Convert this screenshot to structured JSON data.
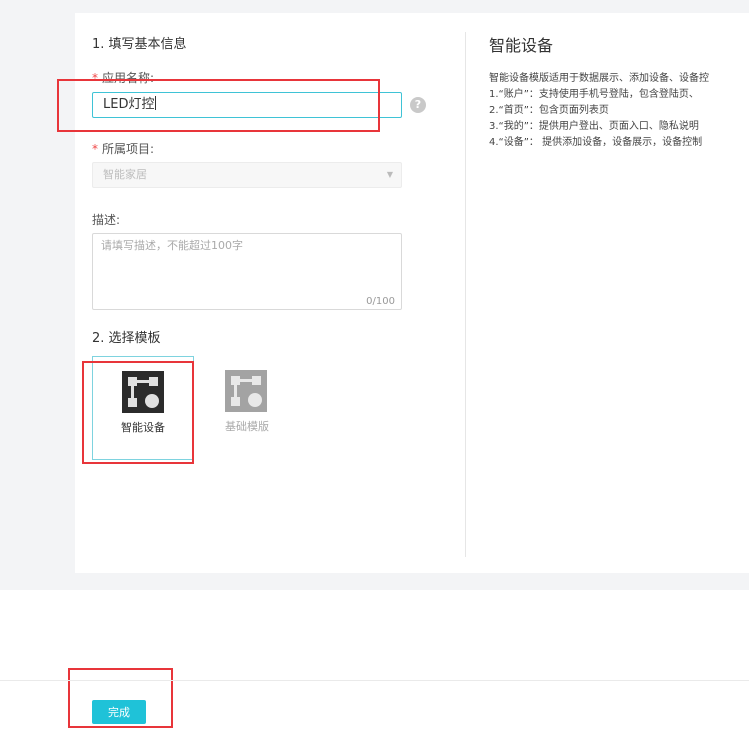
{
  "form": {
    "section1_title": "1. 填写基本信息",
    "app_name": {
      "label": "应用名称:",
      "value": "LED灯控"
    },
    "help_icon": "question-icon",
    "project": {
      "label": "所属项目:",
      "value": "智能家居"
    },
    "description": {
      "label": "描述:",
      "placeholder": "请填写描述，不能超过100字",
      "counter": "0/100"
    },
    "section2_title": "2. 选择模板",
    "templates": [
      {
        "label": "智能设备",
        "selected": true,
        "icon": "template-icon"
      },
      {
        "label": "基础模版",
        "selected": false,
        "icon": "template-icon"
      }
    ]
  },
  "preview": {
    "title": "智能设备",
    "lines": [
      "智能设备模版适用于数据展示、添加设备、设备控",
      "1.“账户”：支持使用手机号登陆，包含登陆页、",
      "2.“首页”：包含页面列表页",
      "3.“我的”：提供用户登出、页面入口、隐私说明",
      "4.“设备”：  提供添加设备，设备展示，设备控制"
    ]
  },
  "footer": {
    "done_label": "完成"
  },
  "colors": {
    "accent": "#1fc2d8",
    "highlight": "#e8353a",
    "required": "#f04848"
  }
}
